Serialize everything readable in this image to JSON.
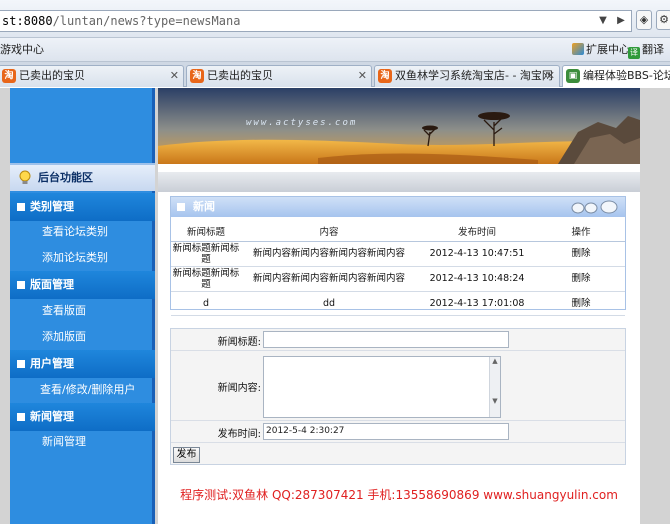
{
  "browser": {
    "url_host": "st:8080",
    "url_path": "/luntan/news?type=newsMana",
    "favorites": {
      "game_center": "游戏中心",
      "extensions": "扩展中心",
      "translate": "翻译"
    },
    "tabs": [
      {
        "label": "已卖出的宝贝",
        "active": false
      },
      {
        "label": "已卖出的宝贝",
        "active": false
      },
      {
        "label": "双鱼林学习系统淘宝店- - 淘宝网",
        "active": false
      },
      {
        "label": "编程体验BBS-论坛 后",
        "active": true
      }
    ],
    "tab_favicon_text": "淘"
  },
  "banner": {
    "watermark": "www.actyses.com"
  },
  "sidebar": {
    "heading": "后台功能区",
    "sections": [
      {
        "title": "类别管理",
        "items": [
          "查看论坛类别",
          "添加论坛类别"
        ]
      },
      {
        "title": "版面管理",
        "items": [
          "查看版面",
          "添加版面"
        ]
      },
      {
        "title": "用户管理",
        "items": [
          "查看/修改/删除用户"
        ]
      },
      {
        "title": "新闻管理",
        "items": [
          "新闻管理"
        ]
      }
    ]
  },
  "news_panel": {
    "title": "新闻",
    "columns": [
      "新闻标题",
      "内容",
      "发布时间",
      "操作"
    ],
    "rows": [
      {
        "title": "新闻标题新闻标题",
        "content": "新闻内容新闻内容新闻内容新闻内容",
        "time": "2012-4-13 10:47:51",
        "action": "删除"
      },
      {
        "title": "新闻标题新闻标题",
        "content": "新闻内容新闻内容新闻内容新闻内容",
        "time": "2012-4-13 10:48:24",
        "action": "删除"
      },
      {
        "title": "d",
        "content": "dd",
        "time": "2012-4-13 17:01:08",
        "action": "删除"
      }
    ]
  },
  "form": {
    "title_label": "新闻标题:",
    "title_value": "",
    "content_label": "新闻内容:",
    "content_value": "",
    "time_label": "发布时间:",
    "time_value": "2012-5-4 2:30:27",
    "submit_label": "发布"
  },
  "footer": {
    "text": "程序测试:双鱼林 QQ:287307421 手机:13558690869 www.shuangyulin.com"
  },
  "colors": {
    "sidebar_blue": "#2e8de0",
    "section_blue": "#0e6dc6",
    "footer_red": "#e02020"
  }
}
